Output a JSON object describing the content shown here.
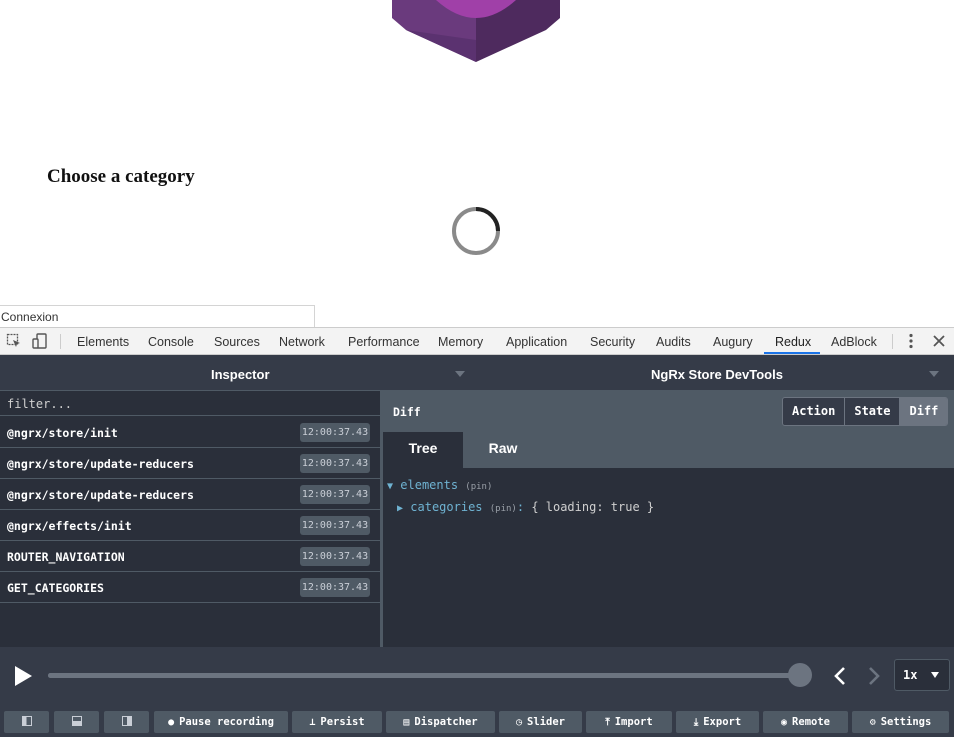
{
  "page": {
    "heading": "Choose a category",
    "status_text": "Connexion"
  },
  "devtools": {
    "tabs": [
      {
        "label": "Elements"
      },
      {
        "label": "Console"
      },
      {
        "label": "Sources"
      },
      {
        "label": "Network"
      },
      {
        "label": "Performance"
      },
      {
        "label": "Memory"
      },
      {
        "label": "Application"
      },
      {
        "label": "Security"
      },
      {
        "label": "Audits"
      },
      {
        "label": "Augury"
      },
      {
        "label": "Redux"
      },
      {
        "label": "AdBlock"
      }
    ],
    "active_tab": "Redux"
  },
  "redux": {
    "monitor_left": "Inspector",
    "monitor_right": "NgRx Store DevTools",
    "filter_placeholder": "filter...",
    "actions": [
      {
        "name": "@ngrx/store/init",
        "time": "12:00:37.43"
      },
      {
        "name": "@ngrx/store/update-reducers",
        "time": "12:00:37.43"
      },
      {
        "name": "@ngrx/store/update-reducers",
        "time": "12:00:37.43"
      },
      {
        "name": "@ngrx/effects/init",
        "time": "12:00:37.43"
      },
      {
        "name": "ROUTER_NAVIGATION",
        "time": "12:00:37.43"
      },
      {
        "name": "GET_CATEGORIES",
        "time": "12:00:37.43"
      }
    ],
    "panel_title": "Diff",
    "modes": [
      {
        "label": "Action"
      },
      {
        "label": "State"
      },
      {
        "label": "Diff"
      }
    ],
    "active_mode": "Diff",
    "subtabs": [
      {
        "label": "Tree"
      },
      {
        "label": "Raw"
      }
    ],
    "active_subtab": "Tree",
    "tree": {
      "root_arrow": "▼",
      "root_key": "elements",
      "root_pin": "(pin)",
      "child_arrow": "▶",
      "child_key": "categories",
      "child_pin": "(pin)",
      "child_sep": ":",
      "child_value": "{ loading: true }"
    },
    "slider": {
      "position": 1.0,
      "speed": "1x"
    },
    "buttons": [
      {
        "label": "Pause recording",
        "icon": "pause-circle-icon"
      },
      {
        "label": "Persist",
        "icon": "pin-icon"
      },
      {
        "label": "Dispatcher",
        "icon": "keyboard-icon"
      },
      {
        "label": "Slider",
        "icon": "timer-icon"
      },
      {
        "label": "Import",
        "icon": "upload-icon"
      },
      {
        "label": "Export",
        "icon": "download-icon"
      },
      {
        "label": "Remote",
        "icon": "broadcast-icon"
      },
      {
        "label": "Settings",
        "icon": "gear-icon"
      }
    ]
  },
  "colors": {
    "panel_bg": "#2a2f3a",
    "header_bg": "#353b48",
    "border": "#4f5a65",
    "key": "#6fb3d2",
    "tab_accent": "#1a73e8"
  }
}
